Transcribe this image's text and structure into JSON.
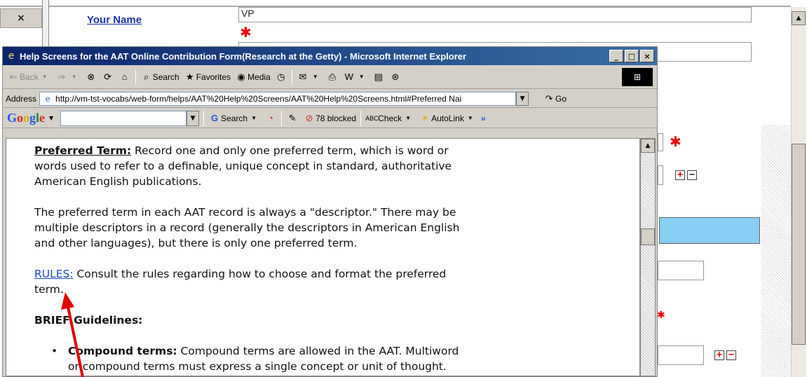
{
  "background_form": {
    "close_glyph": "×",
    "your_name_label": "Your Name",
    "your_name_value": "VP",
    "required_star": "✱"
  },
  "ie_window": {
    "title": "Help Screens for the AAT Online Contribution Form(Research at the Getty) - Microsoft Internet Explorer",
    "window_buttons": {
      "minimize": "_",
      "maximize": "□",
      "close": "×"
    },
    "toolbar": {
      "back": "Back",
      "search": "Search",
      "favorites": "Favorites",
      "media": "Media"
    },
    "address": {
      "label": "Address",
      "url": "http://vm-tst-vocabs/web-form/helps/AAT%20Help%20Screens/AAT%20Help%20Screens.html#Preferred Nai",
      "go": "Go"
    },
    "google_bar": {
      "logo": [
        "G",
        "o",
        "o",
        "g",
        "l",
        "e"
      ],
      "search": "Search",
      "blocked": "78 blocked",
      "check": "Check",
      "autolink": "AutoLink",
      "more": "»"
    },
    "content": {
      "preferred_term_title": "Preferred Term:",
      "preferred_term_body_1": " Record one and only one preferred term, which is word or",
      "preferred_term_body_2": "words used to refer to a definable, unique concept in standard, authoritative",
      "preferred_term_body_3": "American English publications.",
      "descriptor_1": "The preferred term in each AAT record is always a \"descriptor.\" There may be",
      "descriptor_2": "multiple descriptors in a record (generally the descriptors in American English",
      "descriptor_3": "and other languages), but there is only one preferred term.",
      "rules_link": "RULES:",
      "rules_body_1": " Consult the rules regarding how to choose and format the preferred",
      "rules_body_2": "term.",
      "brief_guidelines": "BRIEF Guidelines:",
      "compound_title": "Compound terms:",
      "compound_body_1": " Compound terms are allowed in the AAT. Multiword",
      "compound_body_2": "or compound terms must express a single concept or unit of thought."
    }
  },
  "colors": {
    "title_gradient_start": "#0a246a",
    "title_gradient_end": "#3a6ea5",
    "link": "#1a48b8",
    "required": "#e00000",
    "highlight_band": "#87cef5",
    "arrow": "#e00000"
  }
}
